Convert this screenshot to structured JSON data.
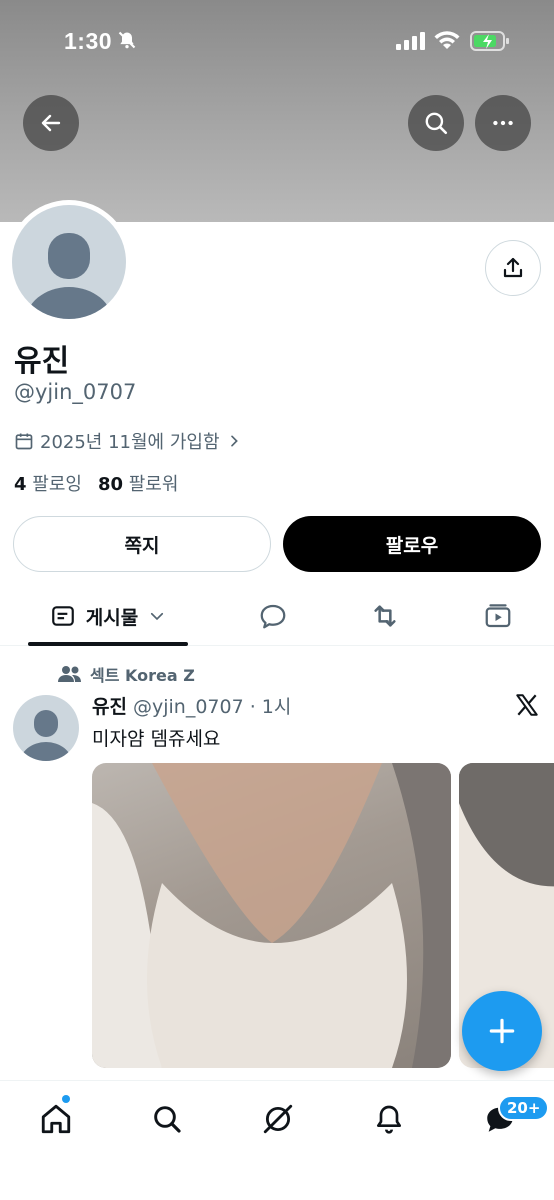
{
  "status_bar": {
    "time": "1:30"
  },
  "profile": {
    "display_name": "유진",
    "handle": "@yjin_0707",
    "joined": "2025년 11월에 가입함",
    "following_count": "4",
    "following_label": "팔로잉",
    "followers_count": "80",
    "followers_label": "팔로워"
  },
  "actions": {
    "dm_label": "쪽지",
    "follow_label": "팔로우"
  },
  "tabs": {
    "posts_label": "게시물"
  },
  "post": {
    "community": "섹트 Korea Z",
    "author_name": "유진",
    "author_meta": "@yjin_0707 · 1시",
    "text": "미자얌 뎀쥬세요"
  },
  "bottom_nav": {
    "messages_badge": "20+"
  },
  "colors": {
    "accent": "#1d9bf0",
    "text": "#0f1419",
    "secondary": "#536471"
  }
}
